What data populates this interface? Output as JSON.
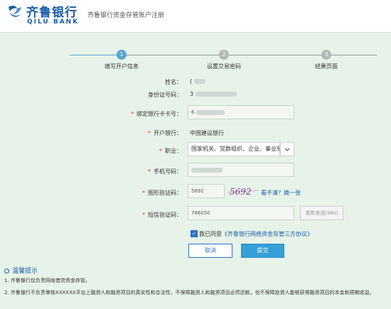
{
  "header": {
    "logo_cn": "齐鲁银行",
    "logo_en": "QILU BANK",
    "subtitle": "齐鲁银行资金存管账户注册"
  },
  "steps": [
    {
      "num": "1",
      "label": "填写开户信息",
      "active": true
    },
    {
      "num": "2",
      "label": "设置交易密码",
      "active": false
    },
    {
      "num": "3",
      "label": "结果页面",
      "active": false
    }
  ],
  "form": {
    "name": {
      "label": "姓名：",
      "value": "("
    },
    "id_number": {
      "label": "身份证号码：",
      "value": "3"
    },
    "bank_card": {
      "label": "绑定银行卡卡号：",
      "value": "6"
    },
    "bank": {
      "label": "开户银行：",
      "value": "中国建设银行"
    },
    "job": {
      "label": "职业：",
      "value": "国家机关、党群组织、企业、事业单位负"
    },
    "phone": {
      "label": "手机号码：",
      "value": ""
    },
    "image_code": {
      "label": "图形验证码：",
      "value": "5692",
      "captcha": "5692",
      "refresh_link": "看不清？换一张"
    },
    "sms_code": {
      "label": "短信验证码：",
      "value": "786050",
      "resend_label": "重新发送(46s)"
    },
    "agree_text": "我已同意",
    "agree_link": "《齐鲁银行网络资金存管三方协议》"
  },
  "buttons": {
    "cancel": "取消",
    "submit": "提交"
  },
  "tips": {
    "title": "温馨提示",
    "items": [
      "1. 齐鲁银行仅负责网络借贷资金存管。",
      "2. 齐鲁银行不负责审核XXXXXX平台上融资人和融资项目的真实性和合法性，不保障融资人和融资项目必然还款，也不保障投资人能够获得融资项目的本金和预期收益。"
    ]
  },
  "colors": {
    "brand": "#1a5ea8",
    "step_active": "#5aa5d8",
    "step_inactive": "#b3b9b5",
    "submit_bg": "#35a0d8",
    "required": "#e33333"
  }
}
